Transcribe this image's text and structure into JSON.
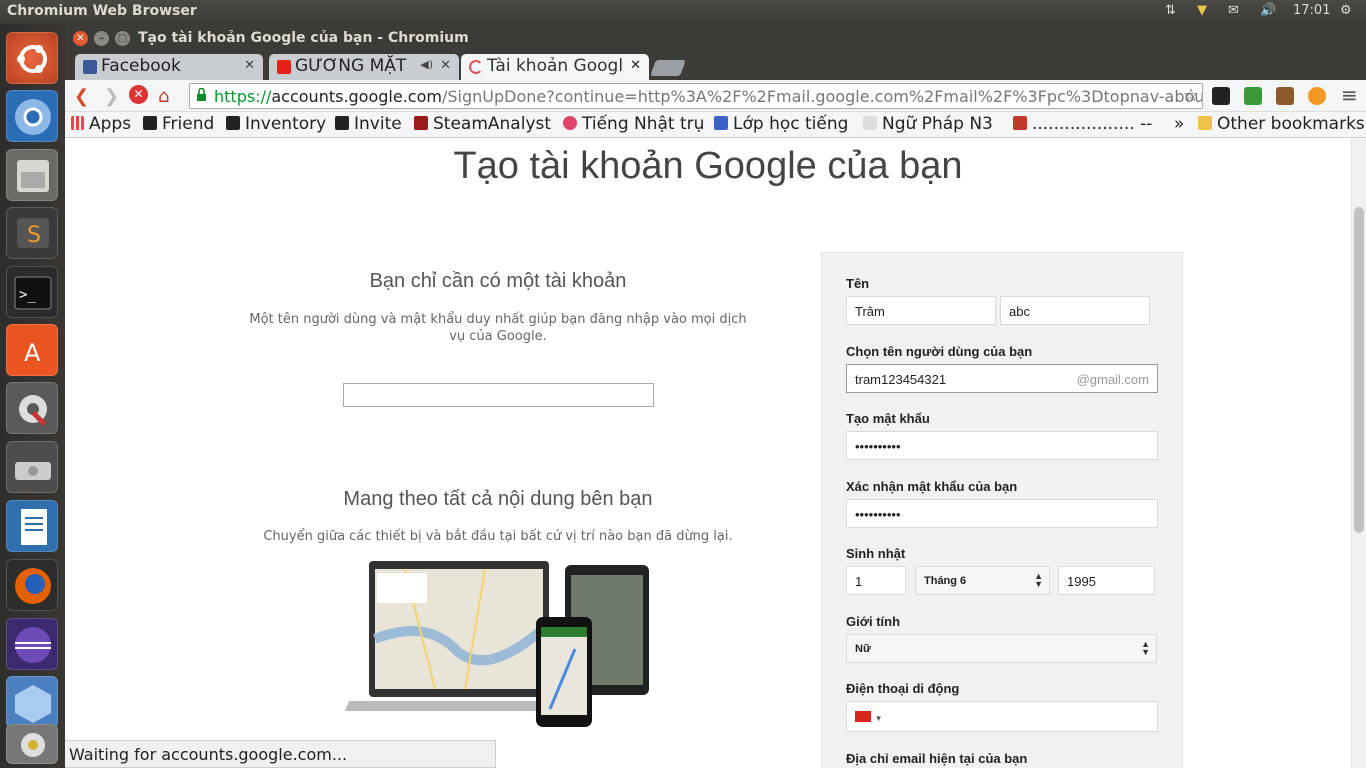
{
  "topbar": {
    "title": "Chromium Web Browser",
    "time": "17:01"
  },
  "window": {
    "title": "Tạo tài khoản Google của bạn - Chromium"
  },
  "tabs": [
    {
      "label": "Facebook",
      "color": "#3b5998"
    },
    {
      "label": "GƯƠNG MẶT",
      "color": "#e62117"
    },
    {
      "label": "Tài khoản Googl",
      "color": "#e8e8e8"
    }
  ],
  "toolbar": {
    "url_scheme": "https://",
    "url_host": "accounts.google.com",
    "url_rest": "/SignUpDone?continue=http%3A%2F%2Fmail.google.com%2Fmail%2F%3Fpc%3Dtopnav-about-vi&service"
  },
  "bookmarks": [
    {
      "label": "Apps",
      "icon": "apps-grid-icon"
    },
    {
      "label": "Friend",
      "icon": "steam-icon"
    },
    {
      "label": "Inventory",
      "icon": "steam-icon"
    },
    {
      "label": "Invite",
      "icon": "steam-icon"
    },
    {
      "label": "SteamAnalyst.c",
      "icon": "steamanalyst-icon"
    },
    {
      "label": "Tiếng Nhật trụ",
      "icon": "flower-icon"
    },
    {
      "label": "Lớp học tiếng",
      "icon": "download-icon"
    },
    {
      "label": "Ngữ Pháp N3",
      "icon": "pah-icon"
    },
    {
      "label": "................... --",
      "icon": "f-icon"
    }
  ],
  "bookmarks_more": "»",
  "other_bookmarks": "Other bookmarks",
  "page": {
    "heading": "Tạo tài khoản Google của bạn",
    "section1_title": "Bạn chỉ cần có một tài khoản",
    "section1_desc": "Một tên người dùng và mật khẩu duy nhất giúp bạn đăng nhập vào mọi dịch vụ của Google.",
    "section2_title": "Mang theo tất cả nội dung bên bạn",
    "section2_desc": "Chuyển giữa các thiết bị và bắt đầu tại bất cứ vị trí nào bạn đã dừng lại."
  },
  "form": {
    "name_label": "Tên",
    "first_name": "Trâm",
    "last_name": "abc",
    "username_label": "Chọn tên người dùng của bạn",
    "username": "tram123454321",
    "username_suffix": "@gmail.com",
    "password_label": "Tạo mật khẩu",
    "password": "••••••••••",
    "confirm_label": "Xác nhận mật khẩu của bạn",
    "confirm": "••••••••••",
    "birthday_label": "Sinh nhật",
    "birth_day": "1",
    "birth_month": "Tháng 6",
    "birth_year": "1995",
    "gender_label": "Giới tính",
    "gender": "Nữ",
    "phone_label": "Điện thoại di động",
    "email_label": "Địa chỉ email hiện tại của bạn"
  },
  "status": "Waiting for accounts.google.com..."
}
